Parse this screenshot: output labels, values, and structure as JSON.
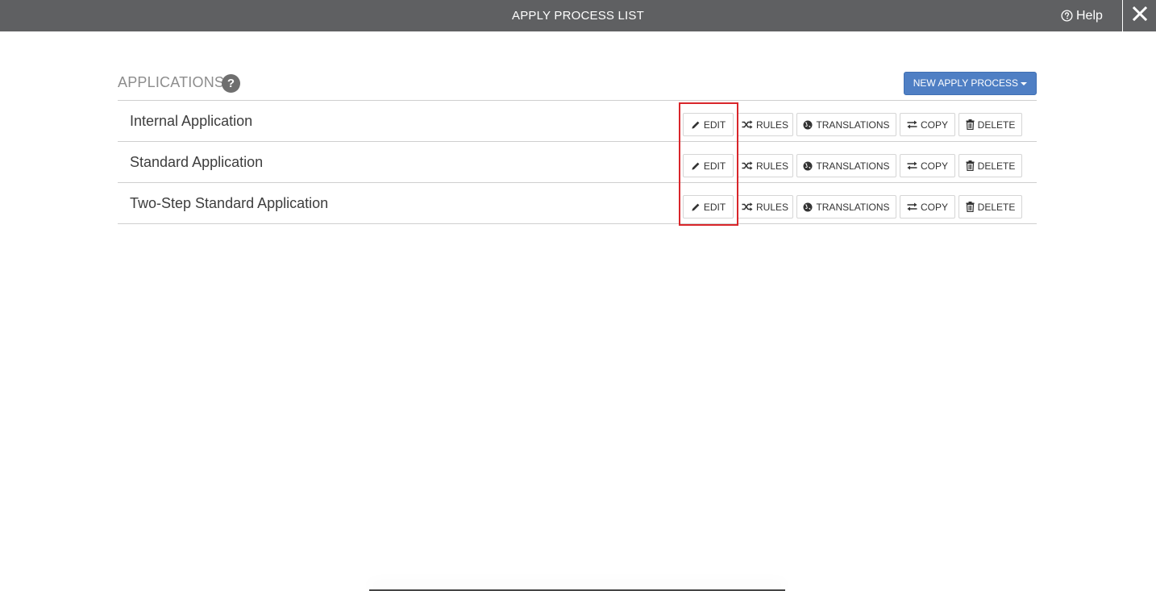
{
  "header": {
    "title": "APPLY PROCESS LIST",
    "help_label": "Help",
    "help_icon": "question-circle-icon",
    "close_icon": "close-icon",
    "background_color": "#5f6062"
  },
  "section": {
    "title": "APPLICATIONS",
    "info_badge": "?",
    "new_button_label": "NEW APPLY PROCESS",
    "new_button_color": "#4f7fc4"
  },
  "applications": [
    {
      "name": "Internal Application"
    },
    {
      "name": "Standard Application"
    },
    {
      "name": "Two-Step Standard Application"
    }
  ],
  "actions": {
    "edit": "EDIT",
    "rules": "RULES",
    "translations": "TRANSLATIONS",
    "copy": "COPY",
    "delete": "DELETE"
  },
  "highlight_color": "#d9262b"
}
